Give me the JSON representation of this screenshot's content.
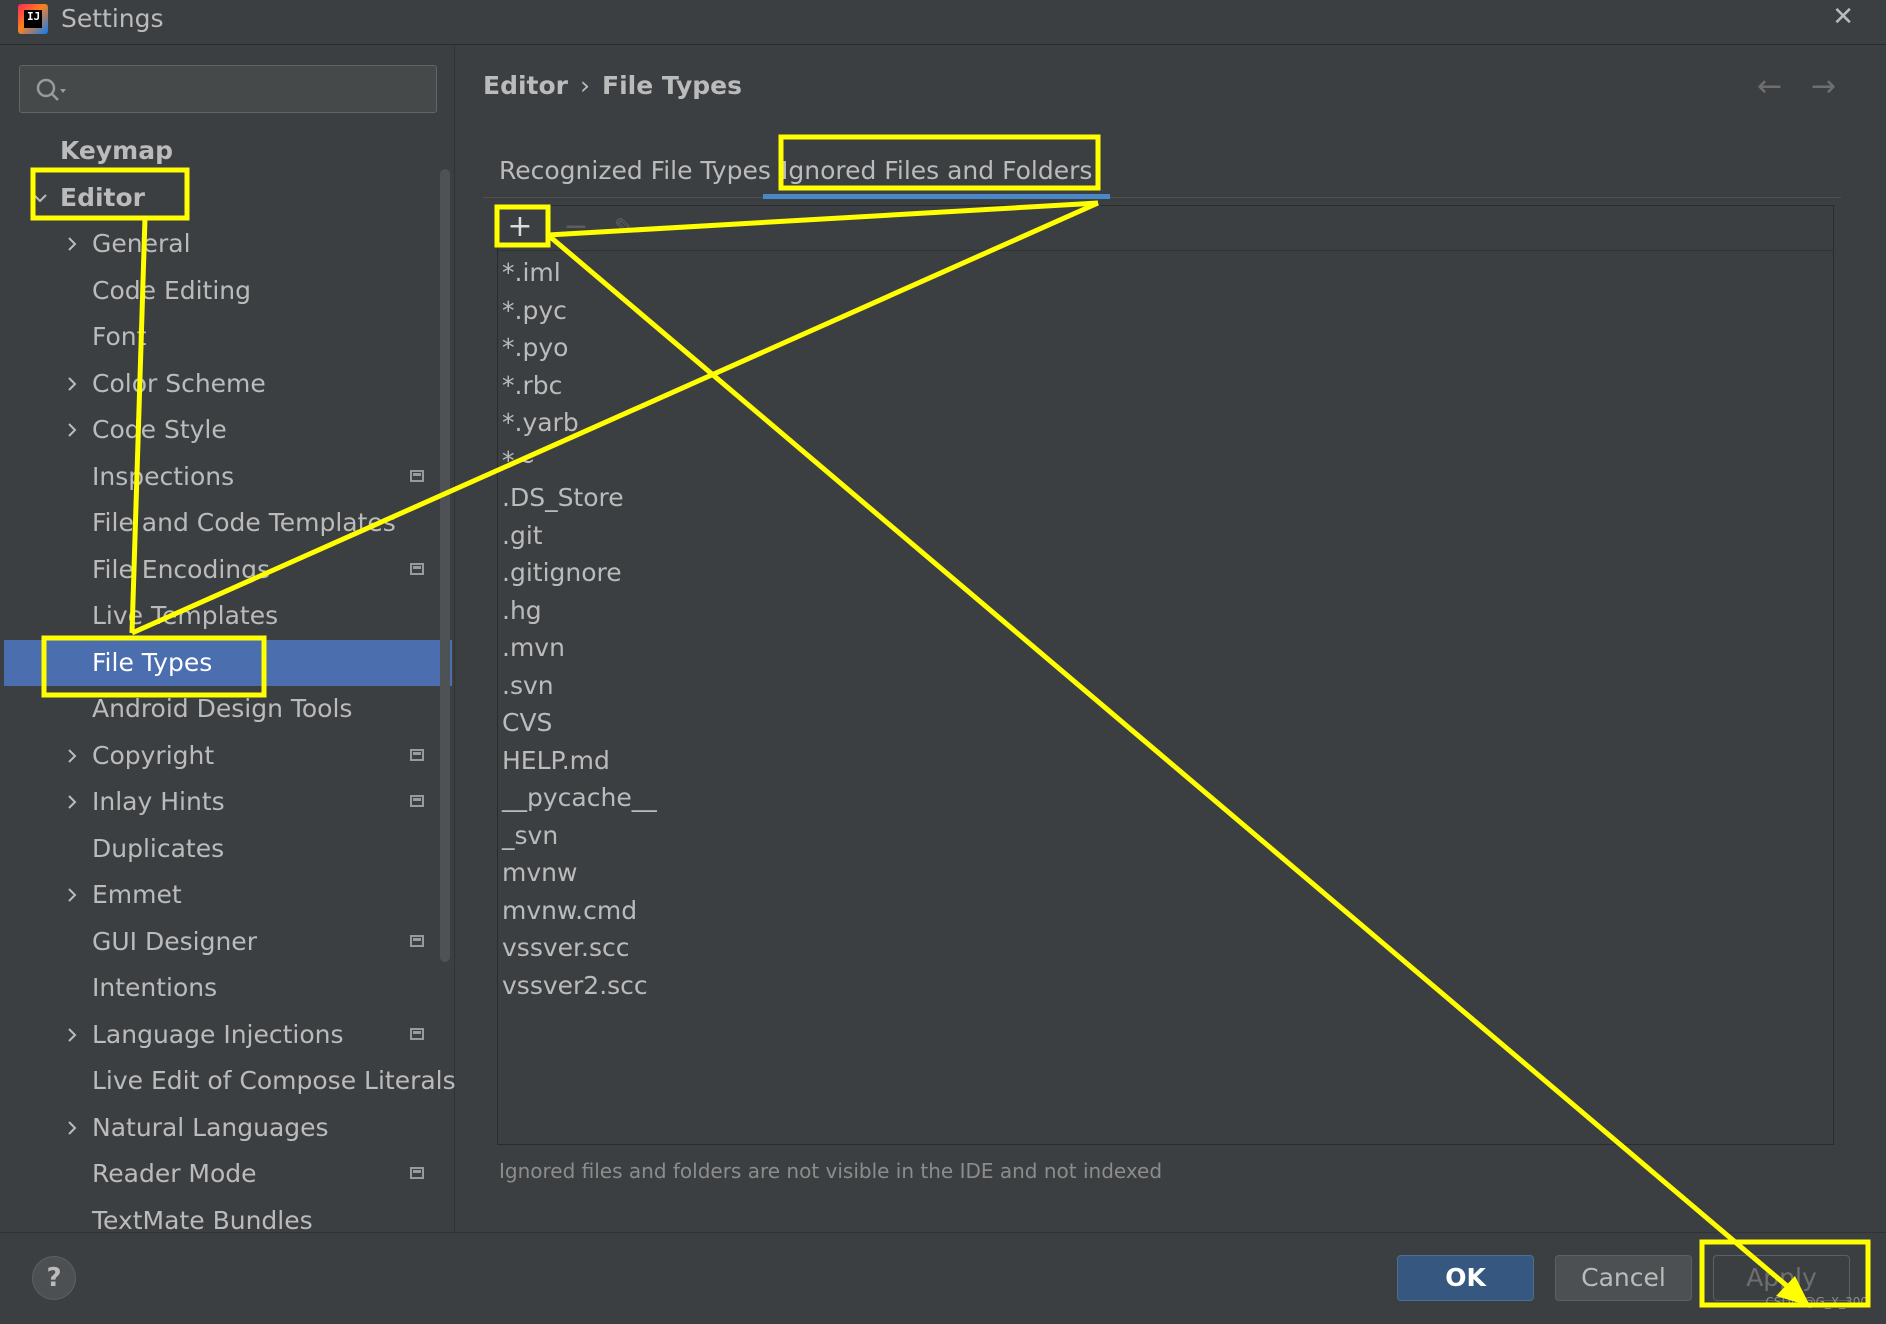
{
  "window": {
    "title": "Settings",
    "app_icon_text": "IJ"
  },
  "search": {
    "placeholder": "",
    "value": ""
  },
  "sidebar": {
    "items": [
      {
        "label": "Keymap",
        "level": 0,
        "expandable": false,
        "expanded": false,
        "has_project_icon": false,
        "selected": false,
        "bold": true
      },
      {
        "label": "Editor",
        "level": 0,
        "expandable": true,
        "expanded": true,
        "has_project_icon": false,
        "selected": false,
        "bold": true
      },
      {
        "label": "General",
        "level": 1,
        "expandable": true,
        "expanded": false,
        "has_project_icon": false,
        "selected": false
      },
      {
        "label": "Code Editing",
        "level": 1,
        "expandable": false,
        "has_project_icon": false,
        "selected": false
      },
      {
        "label": "Font",
        "level": 1,
        "expandable": false,
        "has_project_icon": false,
        "selected": false
      },
      {
        "label": "Color Scheme",
        "level": 1,
        "expandable": true,
        "expanded": false,
        "has_project_icon": false,
        "selected": false
      },
      {
        "label": "Code Style",
        "level": 1,
        "expandable": true,
        "expanded": false,
        "has_project_icon": false,
        "selected": false
      },
      {
        "label": "Inspections",
        "level": 1,
        "expandable": false,
        "has_project_icon": true,
        "selected": false
      },
      {
        "label": "File and Code Templates",
        "level": 1,
        "expandable": false,
        "has_project_icon": false,
        "selected": false
      },
      {
        "label": "File Encodings",
        "level": 1,
        "expandable": false,
        "has_project_icon": true,
        "selected": false
      },
      {
        "label": "Live Templates",
        "level": 1,
        "expandable": false,
        "has_project_icon": false,
        "selected": false
      },
      {
        "label": "File Types",
        "level": 1,
        "expandable": false,
        "has_project_icon": false,
        "selected": true
      },
      {
        "label": "Android Design Tools",
        "level": 1,
        "expandable": false,
        "has_project_icon": false,
        "selected": false
      },
      {
        "label": "Copyright",
        "level": 1,
        "expandable": true,
        "expanded": false,
        "has_project_icon": true,
        "selected": false
      },
      {
        "label": "Inlay Hints",
        "level": 1,
        "expandable": true,
        "expanded": false,
        "has_project_icon": true,
        "selected": false
      },
      {
        "label": "Duplicates",
        "level": 1,
        "expandable": false,
        "has_project_icon": false,
        "selected": false
      },
      {
        "label": "Emmet",
        "level": 1,
        "expandable": true,
        "expanded": false,
        "has_project_icon": false,
        "selected": false
      },
      {
        "label": "GUI Designer",
        "level": 1,
        "expandable": false,
        "has_project_icon": true,
        "selected": false
      },
      {
        "label": "Intentions",
        "level": 1,
        "expandable": false,
        "has_project_icon": false,
        "selected": false
      },
      {
        "label": "Language Injections",
        "level": 1,
        "expandable": true,
        "expanded": false,
        "has_project_icon": true,
        "selected": false
      },
      {
        "label": "Live Edit of Compose Literals",
        "level": 1,
        "expandable": false,
        "has_project_icon": false,
        "selected": false
      },
      {
        "label": "Natural Languages",
        "level": 1,
        "expandable": true,
        "expanded": false,
        "has_project_icon": false,
        "selected": false
      },
      {
        "label": "Reader Mode",
        "level": 1,
        "expandable": false,
        "has_project_icon": true,
        "selected": false
      },
      {
        "label": "TextMate Bundles",
        "level": 1,
        "expandable": false,
        "has_project_icon": false,
        "selected": false
      }
    ]
  },
  "breadcrumb": {
    "parent": "Editor",
    "separator": "›",
    "current": "File Types"
  },
  "nav": {
    "back": "←",
    "forward": "→"
  },
  "tabs": [
    {
      "label": "Recognized File Types",
      "active": false
    },
    {
      "label": "Ignored Files and Folders",
      "active": true
    }
  ],
  "toolbar": {
    "add": "+",
    "remove": "−",
    "edit": "✎"
  },
  "ignored_list": [
    "*.iml",
    "*.pyc",
    "*.pyo",
    "*.rbc",
    "*.yarb",
    "*~",
    ".DS_Store",
    ".git",
    ".gitignore",
    ".hg",
    ".mvn",
    ".svn",
    "CVS",
    "HELP.md",
    "__pycache__",
    "_svn",
    "mvnw",
    "mvnw.cmd",
    "vssver.scc",
    "vssver2.scc"
  ],
  "hint": "Ignored files and folders are not visible in the IDE and not indexed",
  "footer": {
    "help": "?",
    "ok": "OK",
    "cancel": "Cancel",
    "apply": "Apply",
    "watermark": "CSDN @G_X_300"
  },
  "colors": {
    "background": "#3c3f41",
    "selection": "#4b6eaf",
    "ok_button": "#365880",
    "tab_underline": "#4a88c7",
    "annotation": "#ffff00"
  }
}
